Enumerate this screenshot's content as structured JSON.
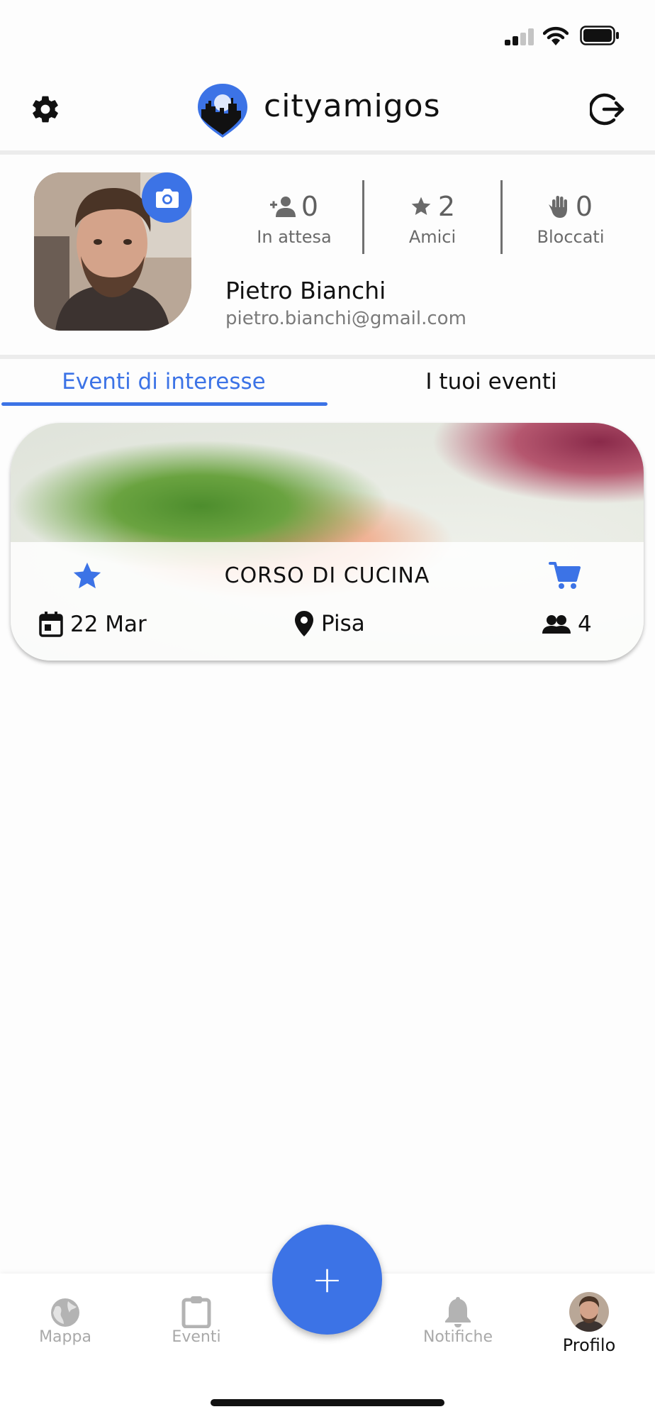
{
  "app": {
    "name": "cityamigos",
    "accent_color": "#3c73e6"
  },
  "header": {
    "settings_icon": "gear-icon",
    "logout_icon": "logout-icon",
    "logo_icon": "city-pin-logo-icon"
  },
  "profile": {
    "name": "Pietro Bianchi",
    "email": "pietro.bianchi@gmail.com",
    "avatar_icon": "avatar",
    "camera_icon": "camera-icon",
    "stats": [
      {
        "icon": "person-pending-icon",
        "value": "0",
        "label": "In attesa"
      },
      {
        "icon": "star-icon",
        "value": "2",
        "label": "Amici"
      },
      {
        "icon": "hand-block-icon",
        "value": "0",
        "label": "Bloccati"
      }
    ]
  },
  "tabs": [
    {
      "label": "Eventi di interesse",
      "active": true
    },
    {
      "label": "I tuoi eventi",
      "active": false
    }
  ],
  "events": [
    {
      "title": "CORSO DI CUCINA",
      "date": "22 Mar",
      "location": "Pisa",
      "participants": "4",
      "starred": true,
      "cart_icon": "cart-icon"
    }
  ],
  "bottom_nav": [
    {
      "label": "Mappa",
      "icon": "globe-icon",
      "active": false
    },
    {
      "label": "Eventi",
      "icon": "clipboard-icon",
      "active": false
    },
    {
      "label": "Notifiche",
      "icon": "bell-icon",
      "active": false
    },
    {
      "label": "Profilo",
      "icon": "avatar",
      "active": true
    }
  ],
  "fab": {
    "label": "+"
  }
}
